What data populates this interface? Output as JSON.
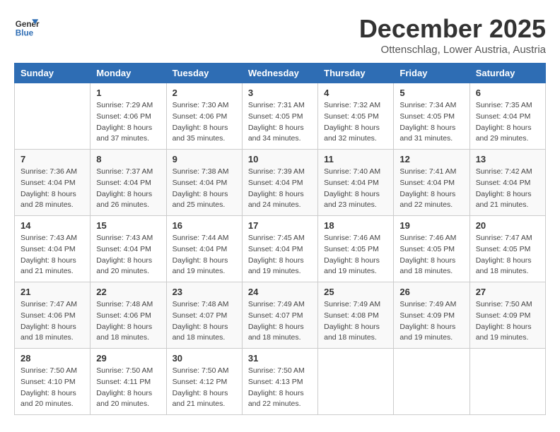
{
  "header": {
    "logo_general": "General",
    "logo_blue": "Blue",
    "month_title": "December 2025",
    "location": "Ottenschlag, Lower Austria, Austria"
  },
  "weekdays": [
    "Sunday",
    "Monday",
    "Tuesday",
    "Wednesday",
    "Thursday",
    "Friday",
    "Saturday"
  ],
  "weeks": [
    [
      {
        "day": "",
        "info": ""
      },
      {
        "day": "1",
        "info": "Sunrise: 7:29 AM\nSunset: 4:06 PM\nDaylight: 8 hours\nand 37 minutes."
      },
      {
        "day": "2",
        "info": "Sunrise: 7:30 AM\nSunset: 4:06 PM\nDaylight: 8 hours\nand 35 minutes."
      },
      {
        "day": "3",
        "info": "Sunrise: 7:31 AM\nSunset: 4:05 PM\nDaylight: 8 hours\nand 34 minutes."
      },
      {
        "day": "4",
        "info": "Sunrise: 7:32 AM\nSunset: 4:05 PM\nDaylight: 8 hours\nand 32 minutes."
      },
      {
        "day": "5",
        "info": "Sunrise: 7:34 AM\nSunset: 4:05 PM\nDaylight: 8 hours\nand 31 minutes."
      },
      {
        "day": "6",
        "info": "Sunrise: 7:35 AM\nSunset: 4:04 PM\nDaylight: 8 hours\nand 29 minutes."
      }
    ],
    [
      {
        "day": "7",
        "info": "Sunrise: 7:36 AM\nSunset: 4:04 PM\nDaylight: 8 hours\nand 28 minutes."
      },
      {
        "day": "8",
        "info": "Sunrise: 7:37 AM\nSunset: 4:04 PM\nDaylight: 8 hours\nand 26 minutes."
      },
      {
        "day": "9",
        "info": "Sunrise: 7:38 AM\nSunset: 4:04 PM\nDaylight: 8 hours\nand 25 minutes."
      },
      {
        "day": "10",
        "info": "Sunrise: 7:39 AM\nSunset: 4:04 PM\nDaylight: 8 hours\nand 24 minutes."
      },
      {
        "day": "11",
        "info": "Sunrise: 7:40 AM\nSunset: 4:04 PM\nDaylight: 8 hours\nand 23 minutes."
      },
      {
        "day": "12",
        "info": "Sunrise: 7:41 AM\nSunset: 4:04 PM\nDaylight: 8 hours\nand 22 minutes."
      },
      {
        "day": "13",
        "info": "Sunrise: 7:42 AM\nSunset: 4:04 PM\nDaylight: 8 hours\nand 21 minutes."
      }
    ],
    [
      {
        "day": "14",
        "info": "Sunrise: 7:43 AM\nSunset: 4:04 PM\nDaylight: 8 hours\nand 21 minutes."
      },
      {
        "day": "15",
        "info": "Sunrise: 7:43 AM\nSunset: 4:04 PM\nDaylight: 8 hours\nand 20 minutes."
      },
      {
        "day": "16",
        "info": "Sunrise: 7:44 AM\nSunset: 4:04 PM\nDaylight: 8 hours\nand 19 minutes."
      },
      {
        "day": "17",
        "info": "Sunrise: 7:45 AM\nSunset: 4:04 PM\nDaylight: 8 hours\nand 19 minutes."
      },
      {
        "day": "18",
        "info": "Sunrise: 7:46 AM\nSunset: 4:05 PM\nDaylight: 8 hours\nand 19 minutes."
      },
      {
        "day": "19",
        "info": "Sunrise: 7:46 AM\nSunset: 4:05 PM\nDaylight: 8 hours\nand 18 minutes."
      },
      {
        "day": "20",
        "info": "Sunrise: 7:47 AM\nSunset: 4:05 PM\nDaylight: 8 hours\nand 18 minutes."
      }
    ],
    [
      {
        "day": "21",
        "info": "Sunrise: 7:47 AM\nSunset: 4:06 PM\nDaylight: 8 hours\nand 18 minutes."
      },
      {
        "day": "22",
        "info": "Sunrise: 7:48 AM\nSunset: 4:06 PM\nDaylight: 8 hours\nand 18 minutes."
      },
      {
        "day": "23",
        "info": "Sunrise: 7:48 AM\nSunset: 4:07 PM\nDaylight: 8 hours\nand 18 minutes."
      },
      {
        "day": "24",
        "info": "Sunrise: 7:49 AM\nSunset: 4:07 PM\nDaylight: 8 hours\nand 18 minutes."
      },
      {
        "day": "25",
        "info": "Sunrise: 7:49 AM\nSunset: 4:08 PM\nDaylight: 8 hours\nand 18 minutes."
      },
      {
        "day": "26",
        "info": "Sunrise: 7:49 AM\nSunset: 4:09 PM\nDaylight: 8 hours\nand 19 minutes."
      },
      {
        "day": "27",
        "info": "Sunrise: 7:50 AM\nSunset: 4:09 PM\nDaylight: 8 hours\nand 19 minutes."
      }
    ],
    [
      {
        "day": "28",
        "info": "Sunrise: 7:50 AM\nSunset: 4:10 PM\nDaylight: 8 hours\nand 20 minutes."
      },
      {
        "day": "29",
        "info": "Sunrise: 7:50 AM\nSunset: 4:11 PM\nDaylight: 8 hours\nand 20 minutes."
      },
      {
        "day": "30",
        "info": "Sunrise: 7:50 AM\nSunset: 4:12 PM\nDaylight: 8 hours\nand 21 minutes."
      },
      {
        "day": "31",
        "info": "Sunrise: 7:50 AM\nSunset: 4:13 PM\nDaylight: 8 hours\nand 22 minutes."
      },
      {
        "day": "",
        "info": ""
      },
      {
        "day": "",
        "info": ""
      },
      {
        "day": "",
        "info": ""
      }
    ]
  ]
}
